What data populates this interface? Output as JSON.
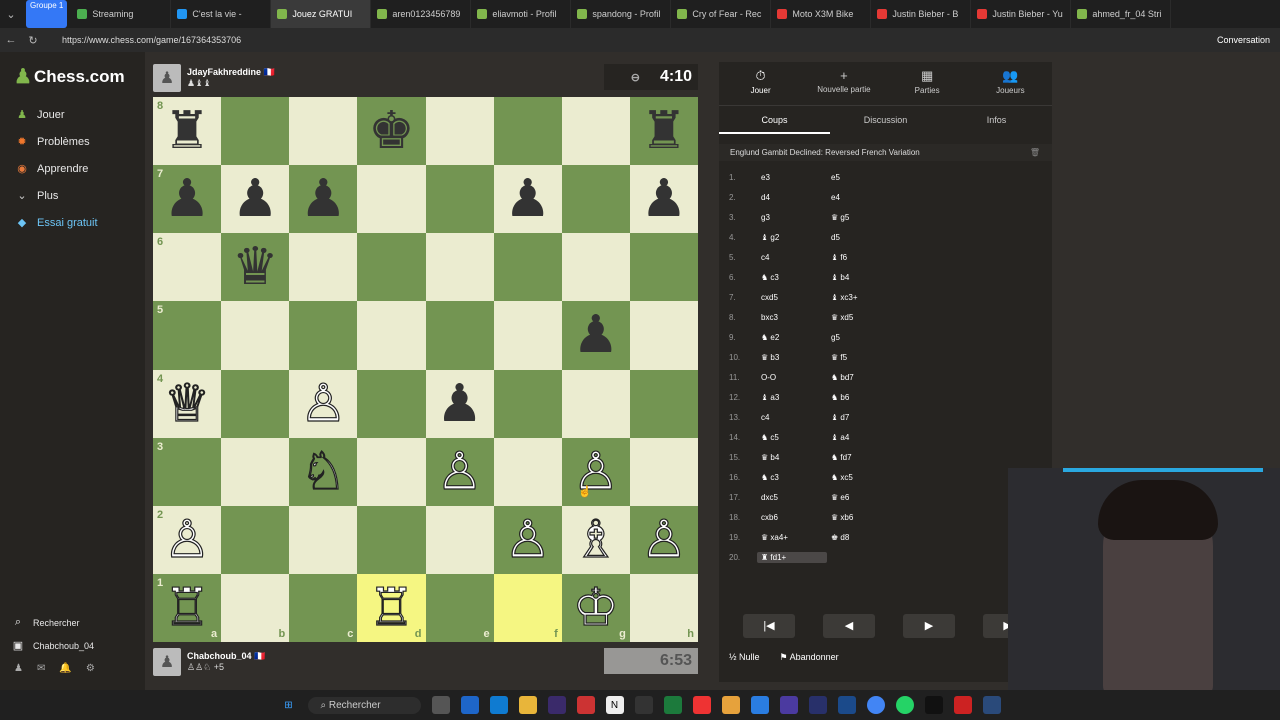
{
  "browser": {
    "group_badge": "Groupe 1",
    "tabs": [
      {
        "label": "Streaming",
        "color": "#4caf50"
      },
      {
        "label": "C'est la vie -",
        "color": "#2196f3"
      },
      {
        "label": "Jouez GRATUI",
        "color": "#81b64c",
        "active": true
      },
      {
        "label": "aren0123456789",
        "color": "#81b64c"
      },
      {
        "label": "eliavmoti - Profil",
        "color": "#81b64c"
      },
      {
        "label": "spandong - Profil",
        "color": "#81b64c"
      },
      {
        "label": "Cry of Fear - Rec",
        "color": "#81b64c"
      },
      {
        "label": "Moto X3M Bike",
        "color": "#e53935"
      },
      {
        "label": "Justin Bieber - B",
        "color": "#e53935"
      },
      {
        "label": "Justin Bieber - Yu",
        "color": "#e53935"
      },
      {
        "label": "ahmed_fr_04 Stri",
        "color": "#81b64c"
      }
    ],
    "url": "https://www.chess.com/game/167364353706",
    "conversation_label": "Conversation"
  },
  "sidebar": {
    "logo": "Chess.com",
    "items": [
      {
        "label": "Jouer",
        "icon": "♟",
        "color": "#81b64c"
      },
      {
        "label": "Problèmes",
        "icon": "✹",
        "color": "#f0772c"
      },
      {
        "label": "Apprendre",
        "icon": "◉",
        "color": "#e8793b"
      },
      {
        "label": "Plus",
        "icon": "⌄",
        "color": "#ccc"
      }
    ],
    "trial": "Essai gratuit",
    "search": "Rechercher",
    "user": "Chabchoub_04"
  },
  "players": {
    "top": {
      "name": "JdayFakhreddine",
      "flag": "🇫🇷",
      "captured": "♟♝♝",
      "clock": "4:10"
    },
    "bottom": {
      "name": "Chabchoub_04",
      "flag": "🇫🇷",
      "captured": "♙♙♘ +5",
      "clock": "6:53"
    }
  },
  "board": {
    "files": [
      "a",
      "b",
      "c",
      "d",
      "e",
      "f",
      "g",
      "h"
    ],
    "ranks": [
      "8",
      "7",
      "6",
      "5",
      "4",
      "3",
      "2",
      "1"
    ],
    "position": [
      [
        "bR",
        "",
        "",
        "bK",
        "",
        "",
        "",
        "bR"
      ],
      [
        "bP",
        "bP",
        "bP",
        "",
        "",
        "bP",
        "",
        "bP"
      ],
      [
        "",
        "bQ",
        "",
        "",
        "",
        "",
        "",
        ""
      ],
      [
        "",
        "",
        "",
        "",
        "",
        "",
        "bP",
        ""
      ],
      [
        "wQ",
        "",
        "wP",
        "",
        "bP",
        "",
        "",
        ""
      ],
      [
        "",
        "",
        "wN",
        "",
        "wP",
        "",
        "wP",
        ""
      ],
      [
        "wP",
        "",
        "",
        "",
        "",
        "wP",
        "wB",
        "wP"
      ],
      [
        "wR",
        "",
        "",
        "wR",
        "",
        "",
        "wK",
        ""
      ]
    ],
    "highlight": [
      "d1",
      "f1"
    ]
  },
  "panel": {
    "top_buttons": [
      {
        "label": "Jouer",
        "icon": "⏱"
      },
      {
        "label": "Nouvelle partie",
        "icon": "+"
      },
      {
        "label": "Parties",
        "icon": "▦"
      },
      {
        "label": "Joueurs",
        "icon": "👥"
      }
    ],
    "tabs": [
      "Coups",
      "Discussion",
      "Infos"
    ],
    "opening": "Englund Gambit Declined: Reversed French Variation",
    "moves": [
      [
        "1.",
        "e3",
        "e5"
      ],
      [
        "2.",
        "d4",
        "e4"
      ],
      [
        "3.",
        "g3",
        "♛ g5"
      ],
      [
        "4.",
        "♝ g2",
        "d5"
      ],
      [
        "5.",
        "c4",
        "♝ f6"
      ],
      [
        "6.",
        "♞ c3",
        "♝ b4"
      ],
      [
        "7.",
        "cxd5",
        "♝ xc3+"
      ],
      [
        "8.",
        "bxc3",
        "♛ xd5"
      ],
      [
        "9.",
        "♞ e2",
        "g5"
      ],
      [
        "10.",
        "♛ b3",
        "♛ f5"
      ],
      [
        "11.",
        "O-O",
        "♞ bd7"
      ],
      [
        "12.",
        "♝ a3",
        "♞ b6"
      ],
      [
        "13.",
        "c4",
        "♝ d7"
      ],
      [
        "14.",
        "♞ c5",
        "♝ a4"
      ],
      [
        "15.",
        "♛ b4",
        "♞ fd7"
      ],
      [
        "16.",
        "♞ c3",
        "♞ xc5"
      ],
      [
        "17.",
        "dxc5",
        "♛ e6"
      ],
      [
        "18.",
        "cxb6",
        "♛ xb6"
      ],
      [
        "19.",
        "♛ xa4+",
        "♚ d8"
      ],
      [
        "20.",
        "♜ fd1+",
        ""
      ]
    ],
    "controls": [
      "|◀",
      "◀",
      "▶",
      "▶|"
    ],
    "draw": "Nulle",
    "resign": "Abandonner"
  },
  "taskbar": {
    "search": "Rechercher"
  }
}
